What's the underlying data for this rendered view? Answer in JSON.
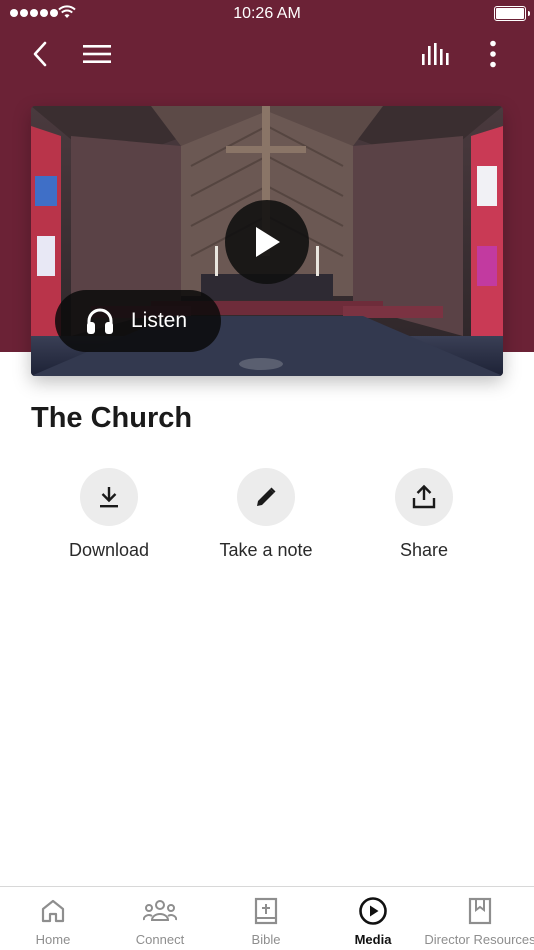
{
  "status_bar": {
    "time": "10:26 AM"
  },
  "nav": {
    "icons": [
      "back-icon",
      "hamburger-menu-icon",
      "equalizer-icon",
      "more-vertical-icon"
    ]
  },
  "colors": {
    "header": "#6b2236",
    "action_circle": "#ececec",
    "tab_active": "#111111",
    "tab_inactive": "#8e8e8e"
  },
  "media": {
    "listen_label": "Listen",
    "title": "The Church"
  },
  "actions": [
    {
      "label": "Download",
      "icon": "download-icon"
    },
    {
      "label": "Take a note",
      "icon": "pencil-icon"
    },
    {
      "label": "Share",
      "icon": "share-icon"
    }
  ],
  "tabs": [
    {
      "label": "Home",
      "icon": "home-icon",
      "active": false
    },
    {
      "label": "Connect",
      "icon": "people-icon",
      "active": false
    },
    {
      "label": "Bible",
      "icon": "bible-icon",
      "active": false
    },
    {
      "label": "Media",
      "icon": "play-circle-icon",
      "active": true
    },
    {
      "label": "Director Resources",
      "icon": "bookmark-book-icon",
      "active": false
    }
  ]
}
